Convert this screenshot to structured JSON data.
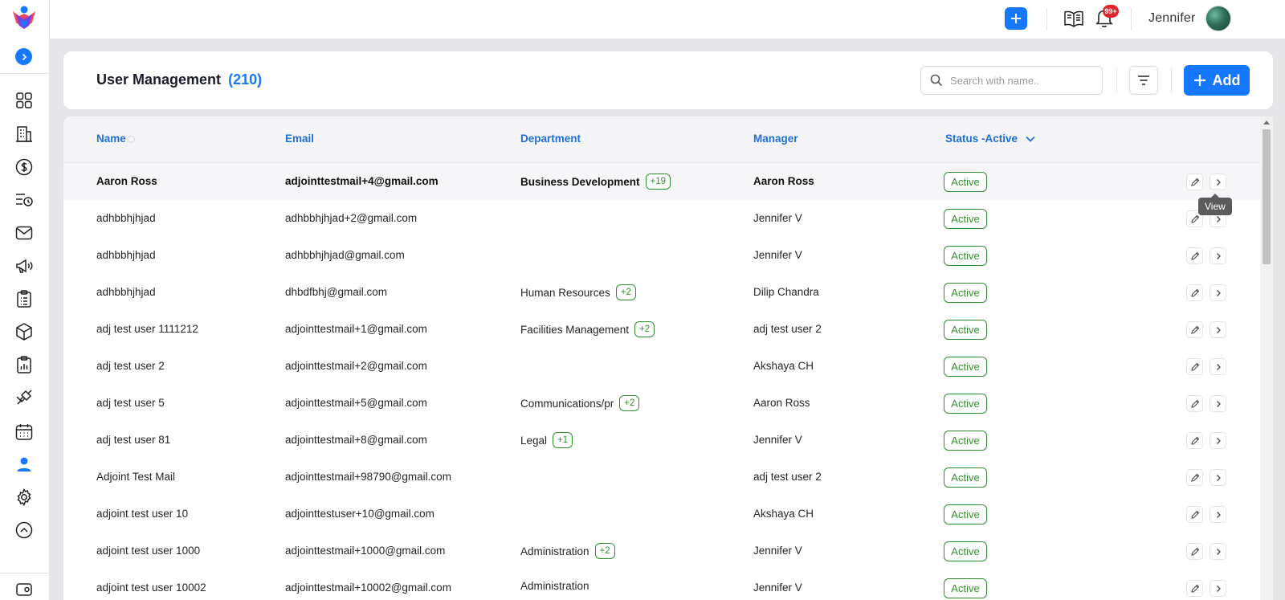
{
  "topbar": {
    "user_name": "Jennifer",
    "notification_badge": "99+",
    "icons": [
      "plus-icon",
      "book-icon",
      "bell-icon",
      "avatar"
    ]
  },
  "sidebar": {
    "items": [
      {
        "icon": "dashboard-grid-icon"
      },
      {
        "icon": "building-icon"
      },
      {
        "icon": "dollar-icon"
      },
      {
        "icon": "list-clock-icon"
      },
      {
        "icon": "mail-icon"
      },
      {
        "icon": "megaphone-icon"
      },
      {
        "icon": "clipboard-list-icon"
      },
      {
        "icon": "cube-icon"
      },
      {
        "icon": "clipboard-chart-icon"
      },
      {
        "icon": "plug-icon"
      },
      {
        "icon": "calendar-icon"
      },
      {
        "icon": "user-icon",
        "active": true
      },
      {
        "icon": "gear-icon"
      },
      {
        "icon": "chevron-up-circle-icon"
      }
    ]
  },
  "header": {
    "title": "User Management",
    "count": "(210)",
    "search_placeholder": "Search with name..",
    "add_label": "Add"
  },
  "table": {
    "columns": {
      "name": "Name",
      "email": "Email",
      "department": "Department",
      "manager": "Manager",
      "status": "Status -Active"
    },
    "rows": [
      {
        "name": "Aaron Ross",
        "email": "adjointtestmail+4@gmail.com",
        "department": "Business Development",
        "dept_more": "+19",
        "manager": "Aaron Ross",
        "status": "Active"
      },
      {
        "name": "adhbbhjhjad",
        "email": "adhbbhjhjad+2@gmail.com",
        "department": "",
        "dept_more": "",
        "manager": "Jennifer V",
        "status": "Active"
      },
      {
        "name": "adhbbhjhjad",
        "email": "adhbbhjhjad@gmail.com",
        "department": "",
        "dept_more": "",
        "manager": "Jennifer V",
        "status": "Active"
      },
      {
        "name": "adhbbhjhjad",
        "email": "dhbdfbhj@gmail.com",
        "department": "Human Resources",
        "dept_more": "+2",
        "manager": "Dilip Chandra",
        "status": "Active"
      },
      {
        "name": "adj test user 1111212",
        "email": "adjointtestmail+1@gmail.com",
        "department": "Facilities Management",
        "dept_more": "+2",
        "manager": "adj test user 2",
        "status": "Active"
      },
      {
        "name": "adj test user 2",
        "email": "adjointtestmail+2@gmail.com",
        "department": "",
        "dept_more": "",
        "manager": "Akshaya CH",
        "status": "Active"
      },
      {
        "name": "adj test user 5",
        "email": "adjointtestmail+5@gmail.com",
        "department": "Communications/pr",
        "dept_more": "+2",
        "manager": "Aaron Ross",
        "status": "Active"
      },
      {
        "name": "adj test user 81",
        "email": "adjointtestmail+8@gmail.com",
        "department": "Legal",
        "dept_more": "+1",
        "manager": "Jennifer V",
        "status": "Active"
      },
      {
        "name": "Adjoint Test Mail",
        "email": "adjointtestmail+98790@gmail.com",
        "department": "",
        "dept_more": "",
        "manager": "adj test user 2",
        "status": "Active"
      },
      {
        "name": "adjoint test user 10",
        "email": "adjointtestuser+10@gmail.com",
        "department": "",
        "dept_more": "",
        "manager": "Akshaya CH",
        "status": "Active"
      },
      {
        "name": "adjoint test user 1000",
        "email": "adjointtestmail+1000@gmail.com",
        "department": "Administration",
        "dept_more": "+2",
        "manager": "Jennifer V",
        "status": "Active"
      },
      {
        "name": "adjoint test user 10002",
        "email": "adjointtestmail+10002@gmail.com",
        "department": "Administration",
        "dept_more": "",
        "manager": "Jennifer V",
        "status": "Active"
      }
    ]
  },
  "tooltip": {
    "text": "View"
  },
  "colors": {
    "accent": "#1677ff",
    "status_green": "#2f8f2f",
    "badge_red": "#e0242b"
  }
}
